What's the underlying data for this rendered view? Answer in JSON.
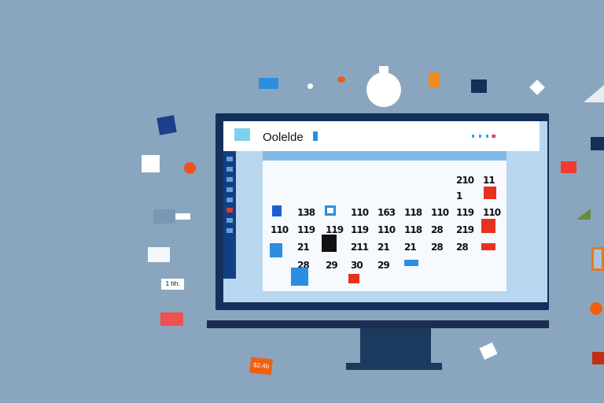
{
  "app": {
    "title": "Oolelde"
  },
  "calendar": {
    "header_row": [
      "‑",
      "‑",
      "‑",
      "‑",
      "‑",
      "‑",
      "‑",
      "‑",
      "‑"
    ],
    "rows": [
      [
        "",
        "",
        "",
        "",
        "",
        "",
        "",
        "210",
        "11"
      ],
      [
        "",
        "",
        "",
        "",
        "",
        "",
        "",
        "1",
        ""
      ],
      [
        "",
        "138",
        "",
        "110",
        "163",
        "118",
        "110",
        "119",
        "110"
      ],
      [
        "110",
        "119",
        "119",
        "119",
        "110",
        "118",
        "28",
        "219",
        ""
      ],
      [
        "",
        "21",
        "",
        "211",
        "21",
        "21",
        "28",
        "28",
        ""
      ],
      [
        "",
        "28",
        "29",
        "30",
        "29",
        "",
        "",
        "",
        ""
      ]
    ]
  },
  "floating": {
    "badge_left": "1 hh:",
    "badge_orange": "$2.4b"
  }
}
